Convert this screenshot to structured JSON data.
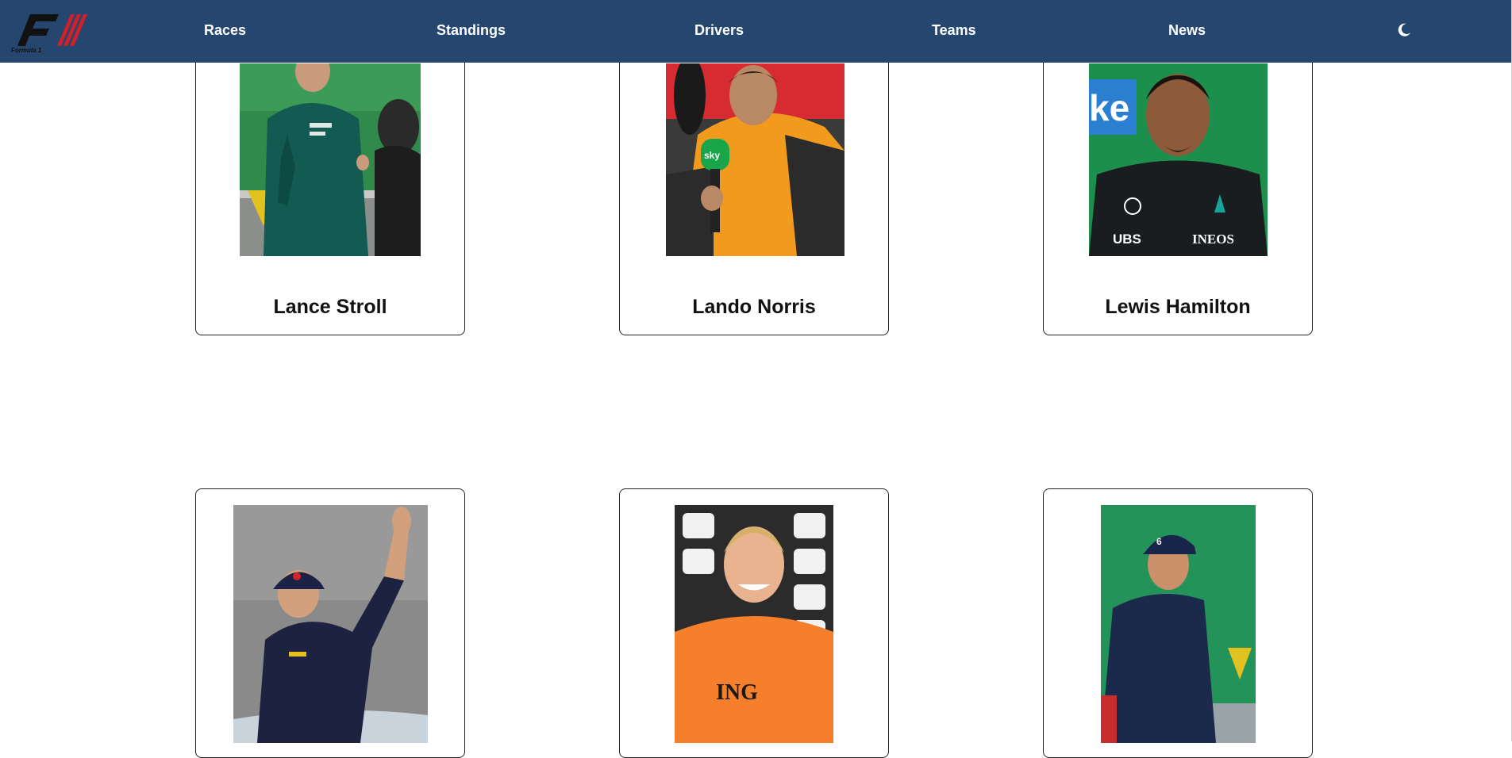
{
  "nav": {
    "links": [
      "Races",
      "Standings",
      "Drivers",
      "Teams",
      "News"
    ],
    "theme_icon": "moon-icon",
    "logo_icon": "f1-logo-icon",
    "bg_color": "#24466f"
  },
  "drivers": [
    {
      "name": "Lance Stroll",
      "photo": "driver-photo-green-jacket"
    },
    {
      "name": "Lando Norris",
      "photo": "driver-photo-orange-jacket"
    },
    {
      "name": "Lewis Hamilton",
      "photo": "driver-photo-black-racesuit"
    },
    {
      "name": "",
      "photo": "driver-photo-navy-waving"
    },
    {
      "name": "",
      "photo": "driver-photo-orange-shirt"
    },
    {
      "name": "",
      "photo": "driver-photo-navy-jacket"
    }
  ]
}
